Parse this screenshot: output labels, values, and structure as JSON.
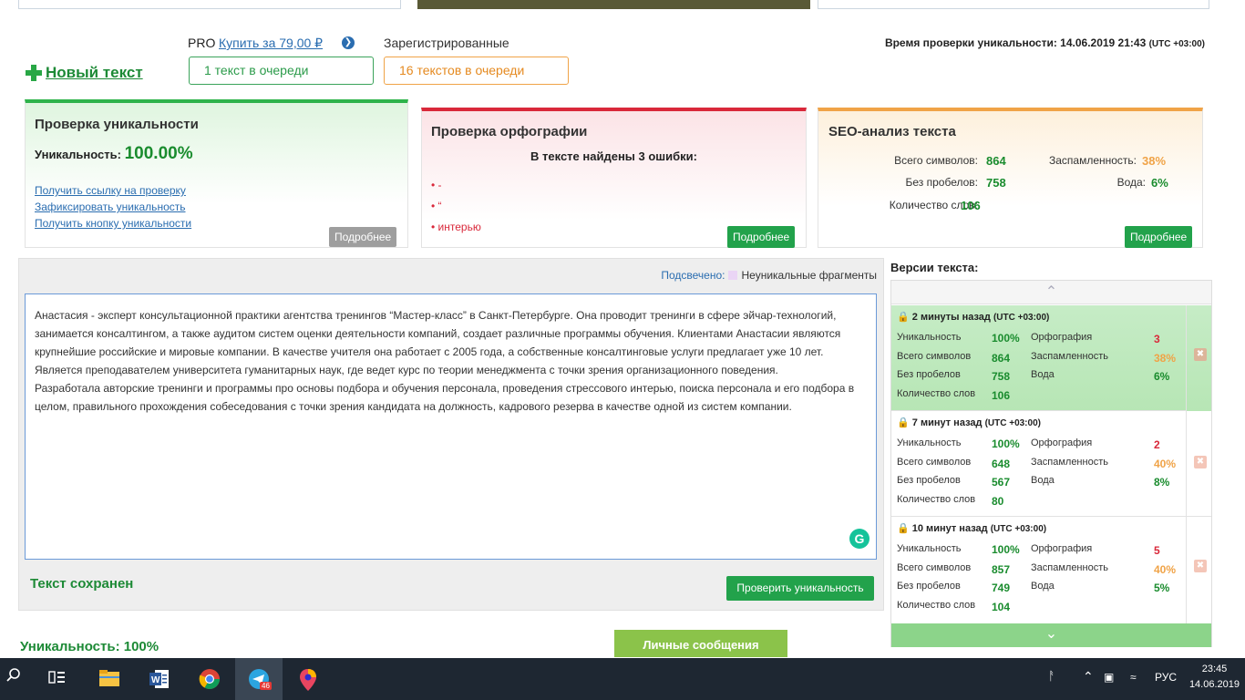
{
  "header": {
    "pro_label": "PRO",
    "pro_link": "Купить за 79,00 ₽",
    "registered_label": "Зарегистрированные",
    "queue_pro": "1 текст в очереди",
    "queue_registered": "16 текстов в очереди",
    "new_text": "Новый текст",
    "check_time_label": "Время проверки уникальности: 14.06.2019 21:43",
    "check_time_tz": "(UTC +03:00)"
  },
  "uniqueness_card": {
    "title": "Проверка уникальности",
    "uniqueness_label": "Уникальность:",
    "uniqueness_value": "100.00%",
    "links": [
      "Получить ссылку на проверку",
      "Зафиксировать уникальность",
      "Получить кнопку уникальности"
    ],
    "more": "Подробнее"
  },
  "spelling_card": {
    "title": "Проверка орфографии",
    "errors_heading": "В тексте найдены 3 ошибки:",
    "errors": [
      "• -",
      "• “",
      "• интерью"
    ],
    "more": "Подробнее"
  },
  "seo_card": {
    "title": "SEO-анализ текста",
    "total_label": "Всего символов:",
    "total_value": "864",
    "nospace_label": "Без пробелов:",
    "nospace_value": "758",
    "words_label": "Количество слов:",
    "words_value": "106",
    "spam_label": "Заспамленность:",
    "spam_value": "38%",
    "water_label": "Вода:",
    "water_value": "6%",
    "more": "Подробнее"
  },
  "editor": {
    "highlight_label": "Подсвечено:",
    "highlight_desc": "Неуникальные фрагменты",
    "paragraph1": "Анастасия - эксперт консультационной практики агентства тренингов “Мастер-класс” в Санкт-Петербурге. Она проводит тренинги в сфере эйчар-технологий, занимается консалтингом, а также аудитом систем оценки деятельности компаний, создает различные программы обучения. Клиентами Анастасии являются крупнейшие российские и мировые компании. В качестве учителя она работает с 2005 года, а собственные консалтинговые услуги предлагает уже 10 лет. Является преподавателем университета гуманитарных наук, где ведет курс по теории менеджмента с точки зрения организационного поведения.",
    "paragraph2": "Разработала авторские тренинги и программы про основы подбора и обучения персонала, проведения стрессового интерью, поиска персонала и его подбора в целом, правильного прохождения собеседования с точки зрения кандидата на должность, кадрового резерва в качестве одной из систем компании.",
    "saved": "Текст сохранен",
    "check_button": "Проверить уникальность"
  },
  "versions": {
    "title": "Версии текста:",
    "labels": {
      "uniq": "Уникальность",
      "total": "Всего символов",
      "nospace": "Без пробелов",
      "words": "Количество слов",
      "spell": "Орфография",
      "spam": "Заспамленность",
      "water": "Вода"
    },
    "items": [
      {
        "time": "2 минуты назад",
        "tz": "(UTC +03:00)",
        "uniq": "100%",
        "total": "864",
        "nospace": "758",
        "words": "106",
        "spell": "3",
        "spam": "38%",
        "water": "6%"
      },
      {
        "time": "7 минут назад",
        "tz": "(UTC +03:00)",
        "uniq": "100%",
        "total": "648",
        "nospace": "567",
        "words": "80",
        "spell": "2",
        "spam": "40%",
        "water": "8%"
      },
      {
        "time": "10 минут назад",
        "tz": "(UTC +03:00)",
        "uniq": "100%",
        "total": "857",
        "nospace": "749",
        "words": "104",
        "spell": "5",
        "spam": "40%",
        "water": "5%"
      }
    ]
  },
  "bottom": {
    "uniqueness": "Уникальность: 100%",
    "messages_button": "Личные сообщения"
  },
  "taskbar": {
    "notification_count": "46",
    "language": "РУС",
    "time": "23:45",
    "date": "14.06.2019"
  }
}
